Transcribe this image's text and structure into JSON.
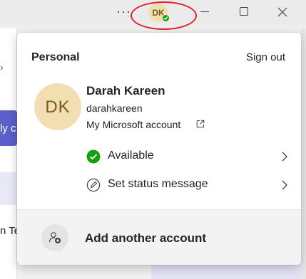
{
  "titlebar": {
    "more_label": "···",
    "avatar_initials": "DK",
    "presence_color": "#13a10e"
  },
  "background": {
    "purple_text": "ly c",
    "bottom_text": "n Te"
  },
  "account_menu": {
    "section_label": "Personal",
    "sign_out_label": "Sign out",
    "avatar_initials": "DK",
    "display_name": "Darah Kareen",
    "username": "darahkareen",
    "account_link_label": "My Microsoft account",
    "account_link_icon": "open-external-icon",
    "status_item": {
      "label": "Available",
      "icon": "available-check-icon",
      "color": "#13a10e"
    },
    "status_message_item": {
      "label": "Set status message",
      "icon": "edit-status-icon"
    },
    "add_account": {
      "label": "Add another account",
      "icon": "add-person-icon"
    }
  },
  "colors": {
    "accent": "#5b5fc7",
    "annotation_ring": "#e0202a",
    "avatar_bg": "#f1deb3",
    "avatar_text": "#7a5a1c"
  }
}
